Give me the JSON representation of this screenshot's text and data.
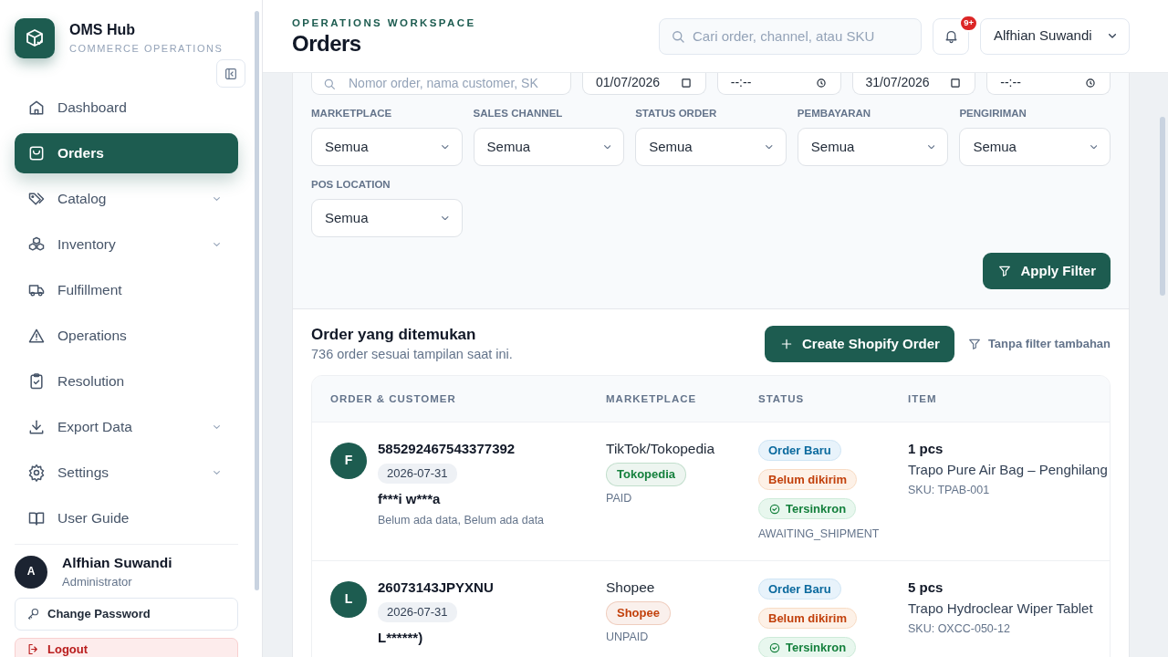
{
  "sidebar": {
    "brand": {
      "name": "OMS Hub",
      "subtitle": "COMMERCE OPERATIONS"
    },
    "items": [
      {
        "label": "Dashboard",
        "selected": false,
        "expandable": false
      },
      {
        "label": "Orders",
        "selected": true,
        "expandable": false
      },
      {
        "label": "Catalog",
        "selected": false,
        "expandable": true
      },
      {
        "label": "Inventory",
        "selected": false,
        "expandable": true
      },
      {
        "label": "Fulfillment",
        "selected": false,
        "expandable": false
      },
      {
        "label": "Operations",
        "selected": false,
        "expandable": false
      },
      {
        "label": "Resolution",
        "selected": false,
        "expandable": false
      },
      {
        "label": "Export Data",
        "selected": false,
        "expandable": true
      },
      {
        "label": "Settings",
        "selected": false,
        "expandable": true
      },
      {
        "label": "User Guide",
        "selected": false,
        "expandable": false
      }
    ],
    "user": {
      "initial": "A",
      "name": "Alfhian Suwandi",
      "role": "Administrator"
    },
    "change_password": "Change Password",
    "logout": "Logout"
  },
  "header": {
    "eyebrow": "OPERATIONS WORKSPACE",
    "title": "Orders",
    "search_placeholder": "Cari order, channel, atau SKU",
    "notification_badge": "9+",
    "user_name": "Alfhian Suwandi"
  },
  "filters": {
    "search_placeholder": "Nomor order, nama customer, SK",
    "date_from": "01/07/2026",
    "time_from": "--:--",
    "date_to": "31/07/2026",
    "time_to": "--:--",
    "selects": [
      {
        "label": "MARKETPLACE",
        "value": "Semua"
      },
      {
        "label": "SALES CHANNEL",
        "value": "Semua"
      },
      {
        "label": "STATUS ORDER",
        "value": "Semua"
      },
      {
        "label": "PEMBAYARAN",
        "value": "Semua"
      },
      {
        "label": "PENGIRIMAN",
        "value": "Semua"
      },
      {
        "label": "POS LOCATION",
        "value": "Semua"
      }
    ],
    "apply_label": "Apply Filter"
  },
  "results": {
    "title": "Order yang ditemukan",
    "subtitle": "736 order sesuai tampilan saat ini.",
    "create_label": "Create Shopify Order",
    "filter_note": "Tanpa filter tambahan",
    "columns": [
      "ORDER & CUSTOMER",
      "MARKETPLACE",
      "STATUS",
      "ITEM"
    ],
    "rows": [
      {
        "initial": "F",
        "order_id": "585292467543377392",
        "date": "2026-07-31",
        "customer": "f***i w***a",
        "address": "Belum ada data, Belum ada data",
        "marketplace": "TikTok/Tokopedia",
        "channel": {
          "label": "Tokopedia",
          "color": "#15803d"
        },
        "payment": "PAID",
        "statuses": [
          {
            "label": "Order Baru",
            "kind": "info"
          },
          {
            "label": "Belum dikirim",
            "kind": "warning"
          },
          {
            "label": "Tersinkron",
            "kind": "synced"
          }
        ],
        "raw_status": "AWAITING_SHIPMENT",
        "qty": "1 pcs",
        "item_name": "Trapo Pure Air Bag – Penghilang",
        "sku": "SKU: TPAB-001"
      },
      {
        "initial": "L",
        "order_id": "26073143JPYXNU",
        "date": "2026-07-31",
        "customer": "L******)",
        "marketplace": "Shopee",
        "channel": {
          "label": "Shopee",
          "color": "#c2410c"
        },
        "payment": "UNPAID",
        "statuses": [
          {
            "label": "Order Baru",
            "kind": "info"
          },
          {
            "label": "Belum dikirim",
            "kind": "warning"
          },
          {
            "label": "Tersinkron",
            "kind": "synced"
          }
        ],
        "qty": "5 pcs",
        "item_name": "Trapo Hydroclear Wiper Tablet",
        "sku": "SKU: OXCC-050-12"
      }
    ]
  }
}
